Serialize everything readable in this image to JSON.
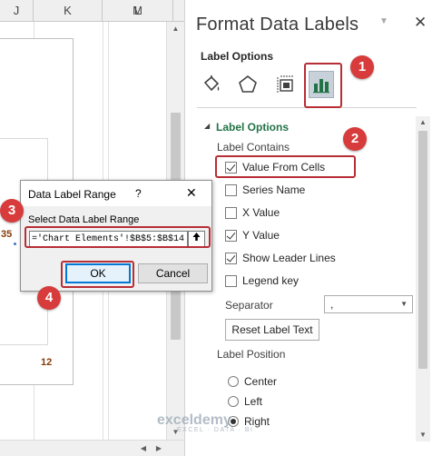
{
  "spreadsheet": {
    "columns": [
      "J",
      "K",
      "L",
      "M"
    ],
    "chart_labels": {
      "partial_left": "35",
      "bottom_value": "12"
    }
  },
  "task_pane": {
    "title": "Format Data Labels",
    "subtitle": "Label Options",
    "icons": [
      "paint-bucket-icon",
      "pentagon-icon",
      "size-properties-icon",
      "bar-chart-icon"
    ],
    "section_title": "Label Options",
    "label_contains": "Label Contains",
    "checkboxes": [
      {
        "label": "Value From Cells",
        "checked": true
      },
      {
        "label": "Series Name",
        "checked": false
      },
      {
        "label": "X Value",
        "checked": false
      },
      {
        "label": "Y Value",
        "checked": true
      },
      {
        "label": "Show Leader Lines",
        "checked": true
      },
      {
        "label": "Legend key",
        "checked": false
      }
    ],
    "separator_label": "Separator",
    "separator_value": ",",
    "reset_button": "Reset Label Text",
    "label_position": "Label Position",
    "positions": [
      {
        "label": "Center",
        "checked": false
      },
      {
        "label": "Left",
        "checked": false
      },
      {
        "label": "Right",
        "checked": true
      }
    ]
  },
  "dialog": {
    "title": "Data Label Range",
    "help": "?",
    "close": "✕",
    "field_label": "Select Data Label Range",
    "field_value": "='Chart Elements'!$B$5:$B$14",
    "ok": "OK",
    "cancel": "Cancel"
  },
  "annotations": [
    "1",
    "2",
    "3",
    "4"
  ],
  "watermark": {
    "main": "exceldemy",
    "sub": "EXCEL · DATA · BI"
  },
  "colors": {
    "accent_green": "#217346",
    "annotation_red": "#d73b3b",
    "highlight_border": "#b72e35",
    "ok_focus": "#0078d7"
  }
}
